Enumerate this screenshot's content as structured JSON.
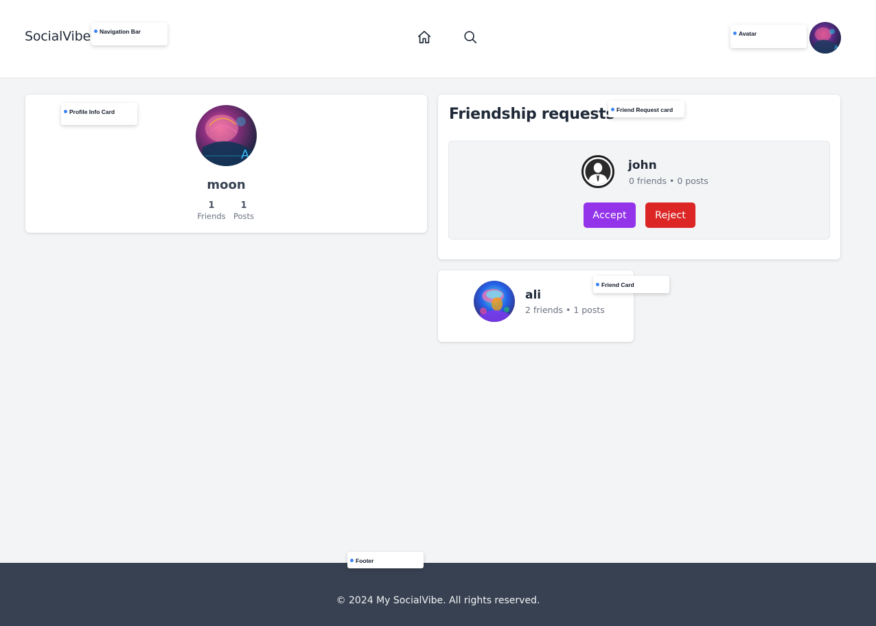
{
  "navbar": {
    "brand": "SocialVibe",
    "icons": [
      "home-icon",
      "search-icon"
    ],
    "avatar_alt": "Avatar"
  },
  "tags": {
    "navigation_bar": "Navigation Bar",
    "avatar": "Avatar",
    "profile_info_card": "Profile Info Card",
    "friend_request_card": "Friend Request card",
    "friend_card": "Friend Card",
    "footer": "Footer"
  },
  "profile": {
    "name": "moon",
    "friends_count": "1",
    "friends_label": "Friends",
    "posts_count": "1",
    "posts_label": "Posts"
  },
  "requests": {
    "title": "Friendship requests",
    "items": [
      {
        "name": "john",
        "meta": "0 friends • 0 posts",
        "accept_label": "Accept",
        "reject_label": "Reject"
      }
    ]
  },
  "friends": [
    {
      "name": "ali",
      "meta": "2 friends • 1 posts"
    }
  ],
  "footer": {
    "text": "© 2024 My SocialVibe. All rights reserved."
  },
  "colors": {
    "accept": "#9333ea",
    "reject": "#dc2626",
    "footer_bg": "#374151",
    "page_bg": "#f3f4f6",
    "tag_dot": "#3b82f6"
  }
}
